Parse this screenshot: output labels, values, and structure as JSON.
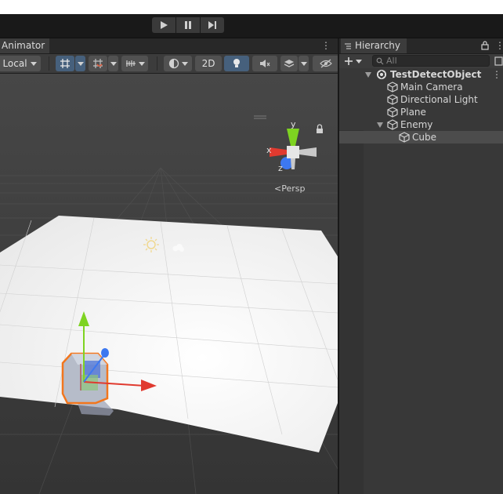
{
  "playbar": {
    "play_icon": "play-icon",
    "pause_icon": "pause-icon",
    "step_icon": "step-icon"
  },
  "scene": {
    "tab_label": "Animator",
    "toolbar": {
      "pivot_label": "Local",
      "mode_2d_label": "2D",
      "icons": [
        "grid-snap-icon",
        "increment-snap-icon",
        "ruler-icon",
        "shading-mode-icon",
        "lighting-icon",
        "audio-icon",
        "effects-icon",
        "visibility-icon"
      ]
    },
    "gizmo": {
      "y_label": "y",
      "x_label": "x",
      "z_label": "z",
      "projection_label": "Persp"
    },
    "colors": {
      "x_axis": "#e03a2f",
      "y_axis": "#7ed321",
      "z_axis": "#3d78f0",
      "selection": "#f2761d"
    }
  },
  "hierarchy": {
    "tab_label": "Hierarchy",
    "search_placeholder": "All",
    "items": [
      {
        "label": "TestDetectObject",
        "depth": 0,
        "expanded": true
      },
      {
        "label": "Main Camera",
        "depth": 1
      },
      {
        "label": "Directional Light",
        "depth": 1
      },
      {
        "label": "Plane",
        "depth": 1
      },
      {
        "label": "Enemy",
        "depth": 1,
        "expanded": true
      },
      {
        "label": "Cube",
        "depth": 2,
        "selected": true
      }
    ]
  }
}
